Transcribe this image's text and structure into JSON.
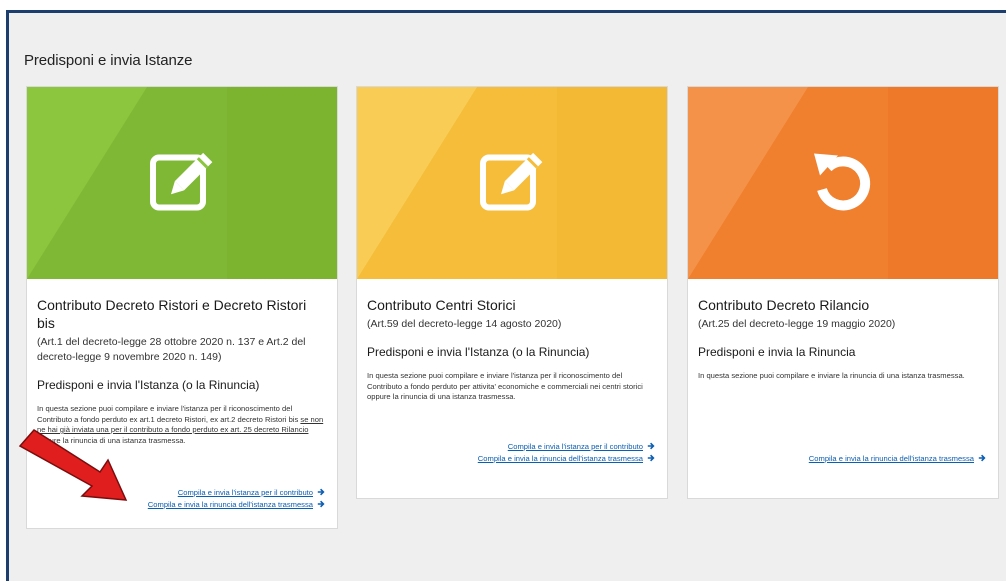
{
  "section": {
    "title": "Predisponi e invia Istanze"
  },
  "colors": {
    "card1": "#8cc63f",
    "card2": "#f7c241",
    "card3": "#f28c3a",
    "link": "#0b5fb3",
    "frame": "#1c3e6e"
  },
  "cards": [
    {
      "icon": "edit-pencil-icon",
      "title": "Contributo Decreto Ristori e Decreto Ristori bis",
      "ref": "(Art.1 del decreto-legge 28 ottobre 2020 n. 137 e Art.2 del decreto-legge 9 novembre 2020 n. 149)",
      "subtitle": "Predisponi e invia l'Istanza (o la Rinuncia)",
      "desc_a": "In questa sezione puoi compilare e inviare l'istanza per il riconoscimento del Contributo a fondo perduto ex art.1 decreto Ristori, ex art.2 decreto Ristori bis ",
      "desc_u": "se non ne hai già inviata una per il contributo a fondo perduto ex art. 25 decreto Rilancio",
      "desc_b": " oppure la rinuncia di una istanza trasmessa.",
      "links": [
        "Compila e invia l'istanza per il contributo",
        "Compila e invia la rinuncia dell'istanza trasmessa"
      ]
    },
    {
      "icon": "edit-pencil-icon",
      "title": "Contributo Centri Storici",
      "ref": "(Art.59 del decreto-legge 14 agosto 2020)",
      "subtitle": "Predisponi e invia l'Istanza (o la Rinuncia)",
      "desc": "In questa sezione puoi compilare e inviare l'istanza per il riconoscimento del Contributo a fondo perduto per attivita' economiche e commerciali nei centri storici oppure la rinuncia di una istanza trasmessa.",
      "links": [
        "Compila e invia l'istanza per il contributo",
        "Compila e invia la rinuncia dell'istanza trasmessa"
      ]
    },
    {
      "icon": "undo-arrow-icon",
      "title": "Contributo Decreto Rilancio",
      "ref": "(Art.25 del decreto-legge 19 maggio 2020)",
      "subtitle": "Predisponi e invia la Rinuncia",
      "desc": "In questa sezione puoi compilare e inviare la rinuncia di una istanza trasmessa.",
      "links": [
        "Compila e invia la rinuncia dell'istanza trasmessa"
      ]
    }
  ]
}
